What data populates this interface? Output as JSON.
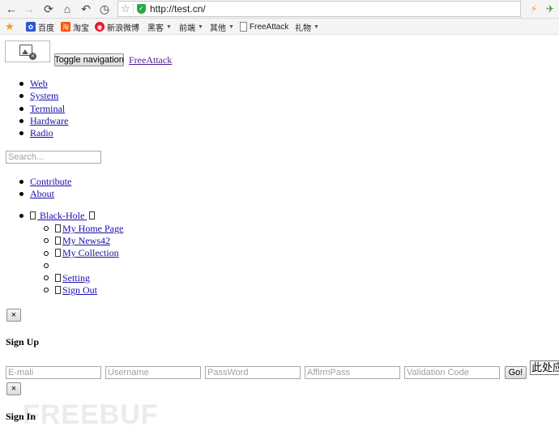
{
  "browser": {
    "url": "http://test.cn/",
    "bookmarks": [
      {
        "label": "百度"
      },
      {
        "label": "淘宝"
      },
      {
        "label": "新浪微博"
      },
      {
        "label": "黑客"
      },
      {
        "label": "前端"
      },
      {
        "label": "其他"
      },
      {
        "label": "FreeAttack"
      },
      {
        "label": "礼物"
      }
    ]
  },
  "page": {
    "toggle_label": "Toggle navigation",
    "brand": "FreeAttack",
    "nav_items": [
      "Web",
      "System",
      "Terminal",
      "Hardware",
      "Radio"
    ],
    "search_placeholder": "Search...",
    "links": [
      "Contribute",
      "About"
    ],
    "user_menu": {
      "label": "Black-Hole",
      "items": [
        "My Home Page",
        "My News42",
        "My Collection",
        "",
        "Setting",
        "Sign Out"
      ]
    },
    "close_label": "×",
    "signup": {
      "title": "Sign Up",
      "email_placeholder": "E-mali",
      "username_placeholder": "Username",
      "password_placeholder": "PassWord",
      "affirm_placeholder": "AffirmPass",
      "code_placeholder": "Validation Code",
      "go_label": "Go!",
      "side_text": "此处应"
    },
    "signin": {
      "title": "Sign In"
    },
    "watermark": "FREEBUF"
  }
}
